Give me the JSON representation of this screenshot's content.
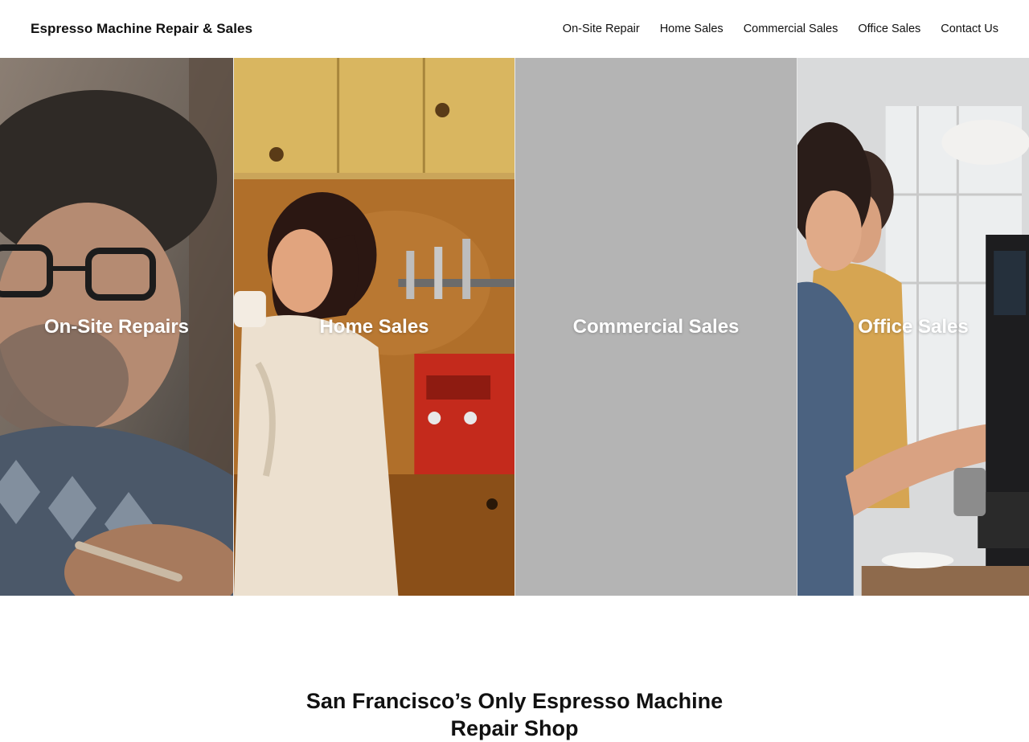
{
  "header": {
    "brand": "Espresso Machine Repair & Sales",
    "nav": [
      {
        "label": "On-Site Repair"
      },
      {
        "label": "Home Sales"
      },
      {
        "label": "Commercial Sales"
      },
      {
        "label": "Office Sales"
      },
      {
        "label": "Contact Us"
      }
    ]
  },
  "panels": [
    {
      "label": "On-Site Repairs",
      "image": "man-with-glasses-photo"
    },
    {
      "label": "Home Sales",
      "image": "woman-drinking-coffee-kitchen-photo"
    },
    {
      "label": "Commercial Sales",
      "image": "gray-placeholder",
      "color": "#b4b4b4"
    },
    {
      "label": "Office Sales",
      "image": "women-at-espresso-machine-photo"
    }
  ],
  "intro": {
    "heading": "San Francisco’s Only Espresso Machine Repair Shop"
  }
}
